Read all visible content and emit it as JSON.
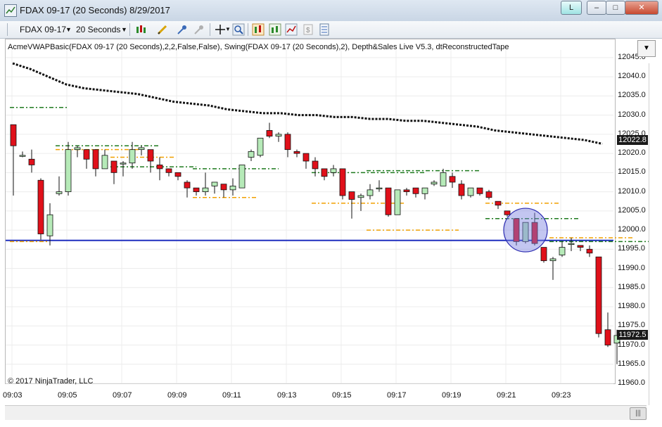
{
  "window": {
    "title": "FDAX 09-17 (20 Seconds)  8/29/2017",
    "btn_l": "L",
    "btn_min": "–",
    "btn_max": "□",
    "btn_close": "✕"
  },
  "toolbar": {
    "instrument": "FDAX 09-17",
    "interval": "20 Seconds"
  },
  "indicator_label": "AcmeVWAPBasic(FDAX 09-17 (20 Seconds),2,2,False,False), Swing(FDAX 09-17 (20 Seconds),2), Depth&Sales Live V5.3, dtReconstructedTape",
  "copyright": "© 2017 NinjaTrader, LLC",
  "price_tags": {
    "top": "12022.8",
    "current": "11972.5"
  },
  "colors": {
    "up": "#b6eab8",
    "down": "#e0101a",
    "vwap": "#111111",
    "support": "#1f2fbf",
    "green_dash": "#1e7a1e",
    "orange_dash": "#f0a000",
    "highlight": "#7a80e0"
  },
  "chart_data": {
    "type": "candlestick",
    "ylim": [
      11960,
      12047
    ],
    "yticks": [
      "12045.0",
      "12040.0",
      "12035.0",
      "12030.0",
      "12025.0",
      "12020.0",
      "12015.0",
      "12010.0",
      "12005.0",
      "12000.0",
      "11995.0",
      "11990.0",
      "11985.0",
      "11980.0",
      "11975.0",
      "11970.0",
      "11965.0",
      "11960.0"
    ],
    "xticks": [
      "09:03",
      "09:05",
      "09:07",
      "09:09",
      "09:11",
      "09:13",
      "09:15",
      "09:17",
      "09:19",
      "09:21",
      "09:23"
    ],
    "support_level": 11997.3,
    "candles": [
      [
        12027.5,
        12022,
        12027.5,
        12009
      ],
      [
        12019.5,
        12019.5,
        12020.5,
        12019
      ],
      [
        12018.5,
        12017,
        12021,
        12015
      ],
      [
        12013,
        11999,
        12013.5,
        11997.5
      ],
      [
        11998.5,
        12004,
        12007,
        11996
      ],
      [
        12009.5,
        12010,
        12014,
        12009
      ],
      [
        12010,
        12021,
        12023,
        12009
      ],
      [
        12021,
        12021.5,
        12022,
        12019
      ],
      [
        12021,
        12018.5,
        12021,
        12016
      ],
      [
        12021,
        12016,
        12021,
        12014
      ],
      [
        12016,
        12019.5,
        12021,
        12016
      ],
      [
        12018,
        12015,
        12018,
        12012
      ],
      [
        12017.5,
        12017.5,
        12018,
        12014
      ],
      [
        12017.5,
        12021,
        12023,
        12016
      ],
      [
        12021,
        12021.5,
        12022,
        12019.5
      ],
      [
        12021,
        12018,
        12021,
        12015
      ],
      [
        12017,
        12016,
        12019,
        12013
      ],
      [
        12016,
        12015,
        12016,
        12014
      ],
      [
        12015,
        12014,
        12015,
        12013
      ],
      [
        12012.5,
        12011,
        12013,
        12008.5
      ],
      [
        12011,
        12010,
        12011,
        12009
      ],
      [
        12010,
        12011,
        12015,
        12009
      ],
      [
        12011.5,
        12012.5,
        12012.5,
        12009.5
      ],
      [
        12012,
        12010.5,
        12012,
        12008.5
      ],
      [
        12010.5,
        12011.5,
        12013.5,
        12009
      ],
      [
        12011,
        12017,
        12017,
        12011
      ],
      [
        12019,
        12020.5,
        12021,
        12018
      ],
      [
        12019.5,
        12024,
        12024,
        12019
      ],
      [
        12026,
        12024.5,
        12028,
        12024
      ],
      [
        12024.5,
        12025,
        12025.5,
        12023
      ],
      [
        12025,
        12021,
        12025.5,
        12019
      ],
      [
        12020.5,
        12020,
        12021,
        12019
      ],
      [
        12020,
        12018,
        12020,
        12016
      ],
      [
        12018,
        12016,
        12019,
        12014
      ],
      [
        12016,
        12014,
        12016,
        12013
      ],
      [
        12015,
        12016,
        12017,
        12014
      ],
      [
        12016,
        12009,
        12016,
        12008
      ],
      [
        12010,
        12008,
        12010,
        12003
      ],
      [
        12008.5,
        12009,
        12009.5,
        12005
      ],
      [
        12009,
        12010.5,
        12012,
        12008
      ],
      [
        12011,
        12011,
        12013,
        12010
      ],
      [
        12011,
        12004,
        12011,
        12003.5
      ],
      [
        12004,
        12010.5,
        12010.5,
        12004
      ],
      [
        12010.5,
        12010,
        12011,
        12009
      ],
      [
        12011,
        12009.5,
        12011,
        12008.5
      ],
      [
        12009.5,
        12011,
        12011,
        12008
      ],
      [
        12012,
        12012.5,
        12013,
        12011.5
      ],
      [
        12011.5,
        12015,
        12016,
        12011.5
      ],
      [
        12014,
        12012.5,
        12015,
        12011
      ],
      [
        12012,
        12009,
        12013,
        12008
      ],
      [
        12009,
        12011,
        12011,
        12008.5
      ],
      [
        12011,
        12009.5,
        12011,
        12009
      ],
      [
        12010,
        12008.5,
        12010.5,
        12008
      ],
      [
        12007.5,
        12006.5,
        12007.5,
        12005.5
      ],
      [
        12005,
        12004,
        12005,
        12003.5
      ],
      [
        12003,
        11997,
        12003,
        11996
      ],
      [
        11997,
        12002,
        12002,
        11996.5
      ],
      [
        12002,
        11996.5,
        12004.5,
        11996
      ],
      [
        11995.5,
        11992,
        11995.5,
        11991.5
      ],
      [
        11992,
        11992.5,
        11993,
        11987
      ],
      [
        11993.5,
        11995.5,
        11997,
        11993
      ],
      [
        11996.5,
        11996.5,
        11998,
        11994.5
      ],
      [
        11996,
        11995.5,
        11996,
        11994.5
      ],
      [
        11995,
        11994,
        11996,
        11993
      ],
      [
        11993,
        11973,
        11993,
        11972
      ],
      [
        11974,
        11970,
        11978.5,
        11969.5
      ],
      [
        11970.5,
        11972.5,
        11974,
        11965
      ]
    ],
    "vwap": [
      12043.5,
      12042,
      12040,
      12038,
      12037,
      12036.5,
      12036,
      12035.5,
      12034.5,
      12033.5,
      12033,
      12032.5,
      12031.5,
      12031,
      12030.5,
      12030.5,
      12030,
      12030,
      12029.5,
      12029.5,
      12029,
      12029,
      12028.5,
      12028.5,
      12028,
      12027.5,
      12027,
      12026,
      12025.5,
      12025,
      12024.5,
      12024,
      12023.5,
      12022.5
    ],
    "green_dash": [
      [
        11997,
        12032,
        0,
        1
      ],
      [
        12021,
        12022,
        5,
        11
      ],
      [
        12019,
        12016.5,
        11,
        15
      ],
      [
        12008.5,
        12016,
        20,
        24
      ],
      [
        12007,
        12015,
        33,
        40
      ],
      [
        12000,
        12015.5,
        39,
        46
      ],
      [
        12007,
        12003,
        52,
        57
      ],
      [
        11998,
        11997,
        59,
        65
      ]
    ]
  }
}
